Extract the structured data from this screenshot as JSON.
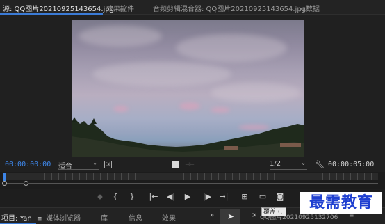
{
  "tabs": {
    "source": "源: QQ图片20210925143654.jpg",
    "source_menu": "≡",
    "effects": "效果控件",
    "mixer": "音频剪辑混合器: QQ图片20210925143654.jpg",
    "metadata": "元数据"
  },
  "monitor": {
    "timecode_current": "00:00:00:00",
    "fit_label": "适合",
    "resolution": "1/2",
    "timecode_duration": "00:00:05:00",
    "playhead_fraction": 0.0
  },
  "icons": {
    "dropdown": "chevron-down-icon",
    "wrench": "wrench-icon",
    "export_frame": "camera-icon"
  },
  "transport": [
    {
      "name": "marker-icon",
      "glyph": "⬥",
      "dim": true
    },
    {
      "name": "mark-in-icon",
      "glyph": "{",
      "dim": false
    },
    {
      "name": "mark-out-icon",
      "glyph": "}",
      "dim": false
    },
    {
      "name": "go-to-in-icon",
      "glyph": "|←",
      "dim": false
    },
    {
      "name": "step-back-icon",
      "glyph": "◀|",
      "dim": false
    },
    {
      "name": "play-icon",
      "glyph": "▶",
      "dim": false
    },
    {
      "name": "step-forward-icon",
      "glyph": "|▶",
      "dim": false
    },
    {
      "name": "go-to-out-icon",
      "glyph": "→|",
      "dim": false
    },
    {
      "name": "insert-icon",
      "glyph": "⊞",
      "dim": false
    },
    {
      "name": "overwrite-icon",
      "glyph": "▭",
      "dim": false
    },
    {
      "name": "camera-icon",
      "glyph": "◙",
      "dim": false
    }
  ],
  "bottom": {
    "project": "项目: Yan",
    "project_menu": "≡",
    "media_browser": "媒体浏览器",
    "library": "库",
    "info": "信息",
    "effects": "效果",
    "overflow": "»",
    "sequence": "QQ图片20210925132706",
    "sequence_menu": "≡",
    "close": "×",
    "tooltip": "覆盖 (."
  },
  "watermark": "最需教育",
  "colors": {
    "accent": "#3e86e8",
    "watermark_text": "#1e3fd0"
  }
}
